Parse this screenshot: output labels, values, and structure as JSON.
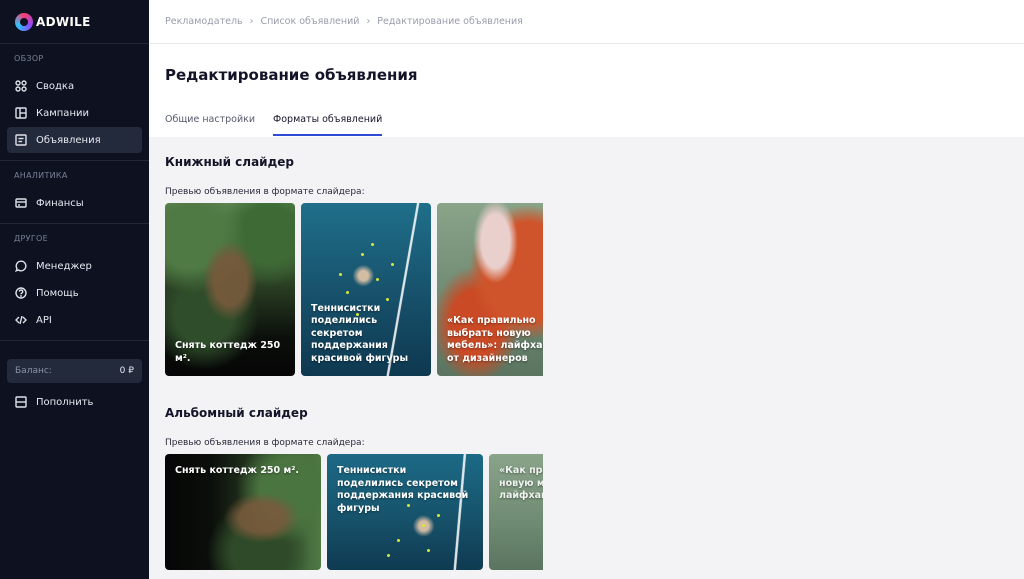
{
  "sidebar": {
    "logo": "ADWILE",
    "sections": [
      {
        "title": "ОБЗОР",
        "items": [
          {
            "label": "Сводка",
            "icon": "dashboard-icon"
          },
          {
            "label": "Кампании",
            "icon": "campaigns-icon"
          },
          {
            "label": "Объявления",
            "icon": "ads-icon",
            "active": true
          }
        ]
      },
      {
        "title": "АНАЛИТИКА",
        "items": [
          {
            "label": "Финансы",
            "icon": "finance-icon"
          }
        ]
      },
      {
        "title": "ДРУГОЕ",
        "items": [
          {
            "label": "Менеджер",
            "icon": "chat-icon"
          },
          {
            "label": "Помощь",
            "icon": "help-icon"
          },
          {
            "label": "API",
            "icon": "code-icon"
          }
        ]
      }
    ],
    "balance": {
      "label": "Баланс:",
      "value": "0 ₽"
    },
    "topup_label": "Пополнить"
  },
  "breadcrumb": [
    "Рекламодатель",
    "Список объявлений",
    "Редактирование объявления"
  ],
  "page_title": "Редактирование объявления",
  "tabs": [
    {
      "label": "Общие настройки",
      "active": false
    },
    {
      "label": "Форматы объявлений",
      "active": true
    }
  ],
  "book_slider": {
    "title": "Книжный слайдер",
    "preview_label": "Превью объявления в формате слайдера:",
    "cards": [
      {
        "text": "Снять коттедж 250 м².",
        "image": "cottage"
      },
      {
        "text": "Теннисистки поделились секретом поддержания красивой фигуры",
        "image": "tennis"
      },
      {
        "text": "«Как правильно выбрать новую мебель»: лайфхак от дизайнеров",
        "image": "sofa"
      }
    ]
  },
  "album_slider": {
    "title": "Альбомный слайдер",
    "preview_label": "Превью объявления в формате слайдера:",
    "cards": [
      {
        "text": "Снять коттедж 250 м².",
        "image": "cottage"
      },
      {
        "text": "Теннисистки поделились секретом поддержания красивой фигуры",
        "image": "tennis"
      },
      {
        "text": "«Как правильно выбрать новую мебель»: лайфхак от дизайнеров",
        "image": "sofa"
      }
    ]
  }
}
